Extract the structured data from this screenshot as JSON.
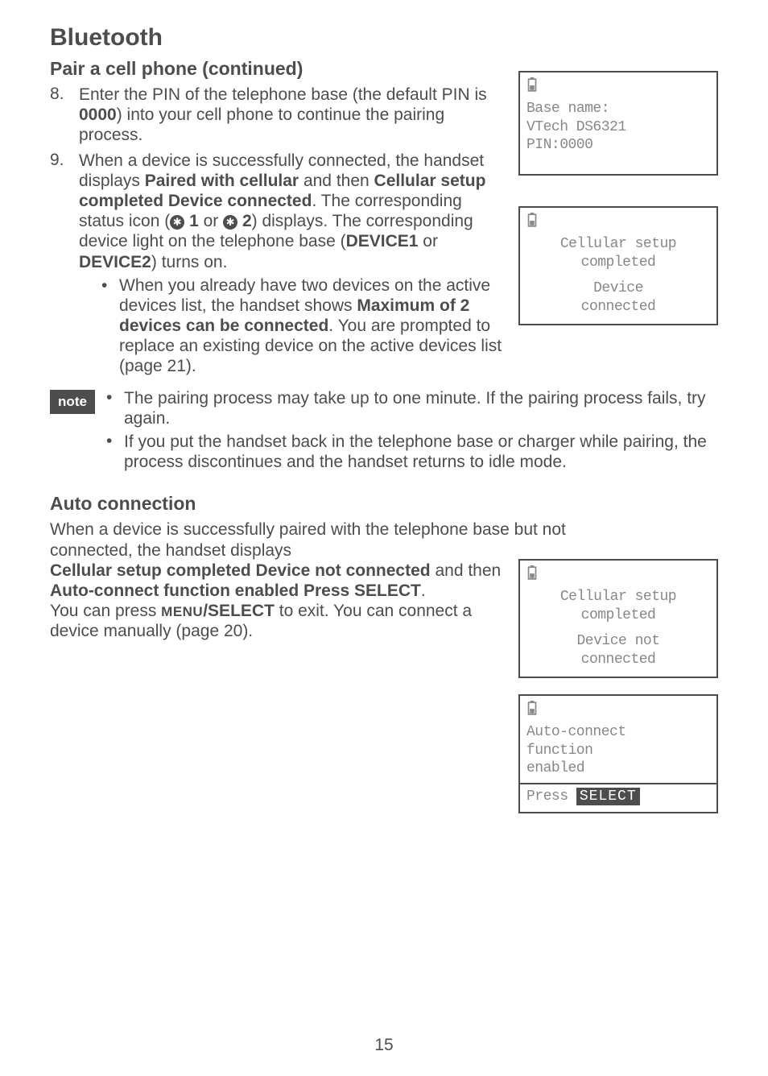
{
  "headings": {
    "h1": "Bluetooth",
    "h2a": "Pair a cell phone (continued)",
    "h2b": "Auto connection"
  },
  "steps": {
    "s8": {
      "num": "8.",
      "p1": "Enter the PIN of the telephone base (the default PIN is ",
      "bold1": "0000",
      "p2": ") into your cell phone to continue the pairing process."
    },
    "s9": {
      "num": "9.",
      "p1": "When a device is successfully connected, the handset displays ",
      "b1": "Paired with cellular",
      "p2": " and then ",
      "b2": "Cellular setup completed Device connected",
      "p3": ". The corresponding status icon (",
      "b3": "1",
      "p4": " or ",
      "b4": "2",
      "p5": ") displays. The corresponding device light on the telephone base (",
      "b5": "DEVICE1",
      "p6": " or ",
      "b6": "DEVICE2",
      "p7": ") turns on."
    },
    "s9sub": {
      "p1": "When you already have two devices on the active devices list, the handset shows ",
      "b1": "Maximum of 2 devices can be connected",
      "p2": ". You are prompted to replace an existing device on the active devices list (page 21)."
    }
  },
  "note": {
    "label": "note",
    "n1": "The pairing process may take up to one minute. If the pairing process fails, try again.",
    "n2": "If you put the handset back in the telephone base or charger while pairing, the process discontinues and the handset returns to idle mode."
  },
  "auto": {
    "p1": "When a device is successfully paired with the telephone base but not connected, the handset displays ",
    "b1": "Cellular setup completed Device not connected",
    "p2": " and then ",
    "b2": "Auto-connect function enabled Press SELECT",
    "p3": ".",
    "p4a": "You can press ",
    "menu_select": "MENU",
    "select_bold": "/SELECT",
    "p4b": " to exit. You can connect a device manually (page 20)."
  },
  "lcd1": {
    "l1": "Base name:",
    "l2": "VTech DS6321",
    "l3": "PIN:0000"
  },
  "lcd2": {
    "l1": "Cellular setup",
    "l2": "completed",
    "l3": "Device",
    "l4": "connected"
  },
  "lcd3": {
    "l1": "Cellular setup",
    "l2": "completed",
    "l3": "Device not",
    "l4": "connected"
  },
  "lcd4": {
    "l1": "Auto-connect",
    "l2": "function",
    "l3": "enabled",
    "press": "Press",
    "select": "SELECT"
  },
  "page": "15"
}
